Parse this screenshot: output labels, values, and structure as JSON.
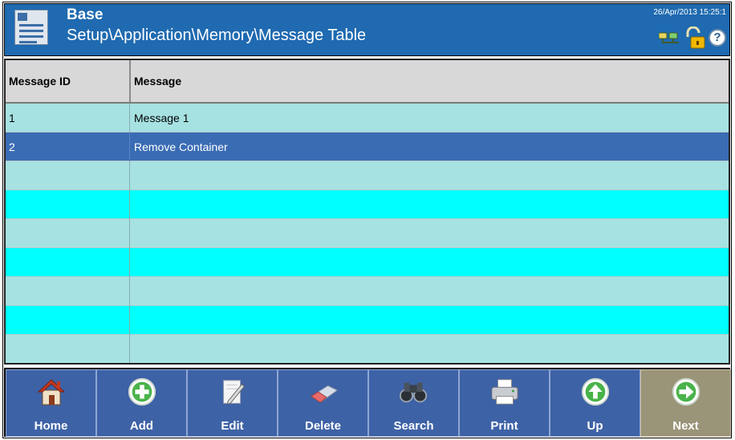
{
  "header": {
    "title": "Base",
    "path": "Setup\\Application\\Memory\\Message Table",
    "datetime": "26/Apr/2013 15:25:1",
    "status_icons": [
      "network-icon",
      "lock-icon",
      "help-icon"
    ],
    "help_glyph": "?"
  },
  "table": {
    "columns": [
      "Message ID",
      "Message"
    ],
    "rows": [
      {
        "id": "1",
        "message": "Message 1"
      },
      {
        "id": "2",
        "message": "Remove Container",
        "selected": true
      },
      {
        "id": "",
        "message": ""
      },
      {
        "id": "",
        "message": ""
      },
      {
        "id": "",
        "message": ""
      },
      {
        "id": "",
        "message": ""
      },
      {
        "id": "",
        "message": ""
      },
      {
        "id": "",
        "message": ""
      },
      {
        "id": "",
        "message": ""
      }
    ]
  },
  "toolbar": {
    "buttons": [
      {
        "label": "Home",
        "icon": "home-icon"
      },
      {
        "label": "Add",
        "icon": "add-icon"
      },
      {
        "label": "Edit",
        "icon": "edit-icon"
      },
      {
        "label": "Delete",
        "icon": "eraser-icon"
      },
      {
        "label": "Search",
        "icon": "binoculars-icon"
      },
      {
        "label": "Print",
        "icon": "printer-icon"
      },
      {
        "label": "Up",
        "icon": "arrow-up-icon"
      },
      {
        "label": "Next",
        "icon": "arrow-right-icon"
      }
    ]
  },
  "colors": {
    "header_bg": "#1f6ab0",
    "row_odd": "#a7e2e3",
    "row_even": "#00ffff",
    "row_selected": "#3a6cb4",
    "toolbar_button": "#3e62a6",
    "next_button": "#9a9478"
  }
}
